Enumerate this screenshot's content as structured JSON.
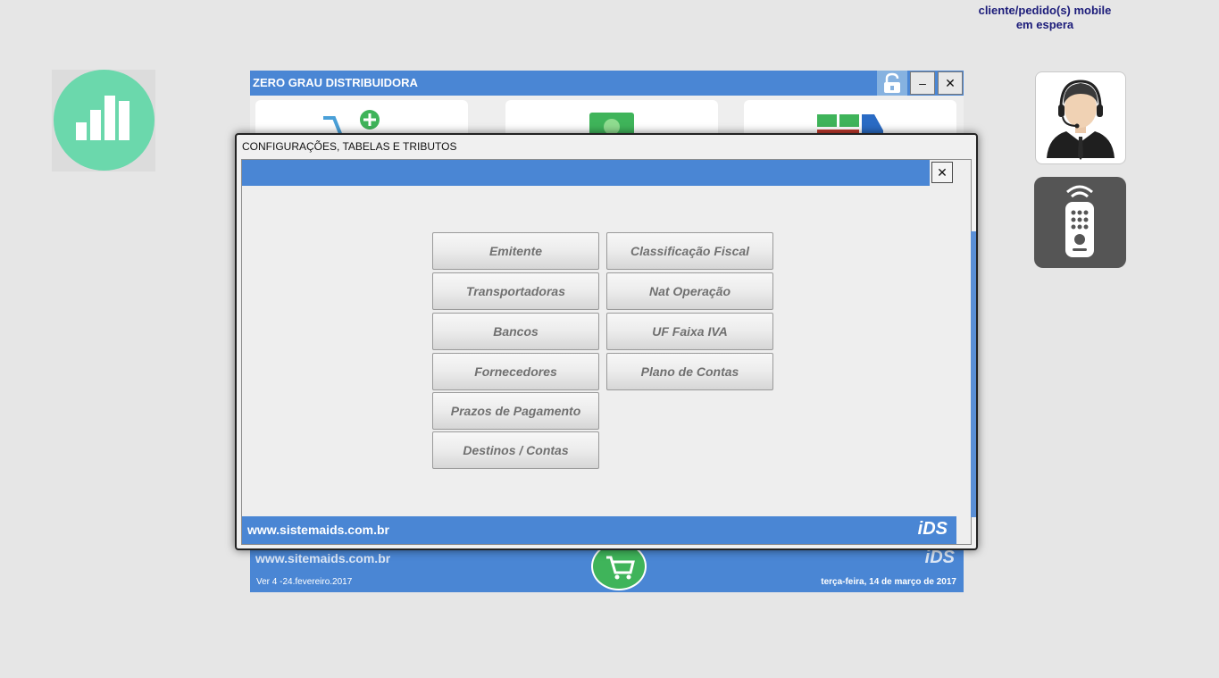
{
  "mobile_notice": {
    "line1": "cliente/pedido(s) mobile",
    "line2": "em espera"
  },
  "main_window": {
    "title": "ZERO GRAU DISTRIBUIDORA",
    "minimize_label": "–",
    "close_label": "✕",
    "footer_site": "www.sitemaids.com.br",
    "footer_logo": "iDS",
    "version": "Ver 4  -24.fevereiro.2017",
    "date": "terça-feira, 14 de março de 2017"
  },
  "modal": {
    "title": "CONFIGURAÇÕES, TABELAS E TRIBUTOS",
    "close_label": "✕",
    "footer_site": "www.sistemaids.com.br",
    "footer_logo": "iDS",
    "buttons_left": [
      "Emitente",
      "Transportadoras",
      "Bancos",
      "Fornecedores",
      "Prazos de Pagamento",
      "Destinos / Contas"
    ],
    "buttons_right": [
      "Classificação Fiscal",
      "Nat Operação",
      "UF Faixa IVA",
      "Plano de Contas"
    ]
  },
  "colors": {
    "accent_blue": "#4a86d4",
    "chart_green": "#6bd8ac",
    "cart_green": "#3fb45a"
  }
}
